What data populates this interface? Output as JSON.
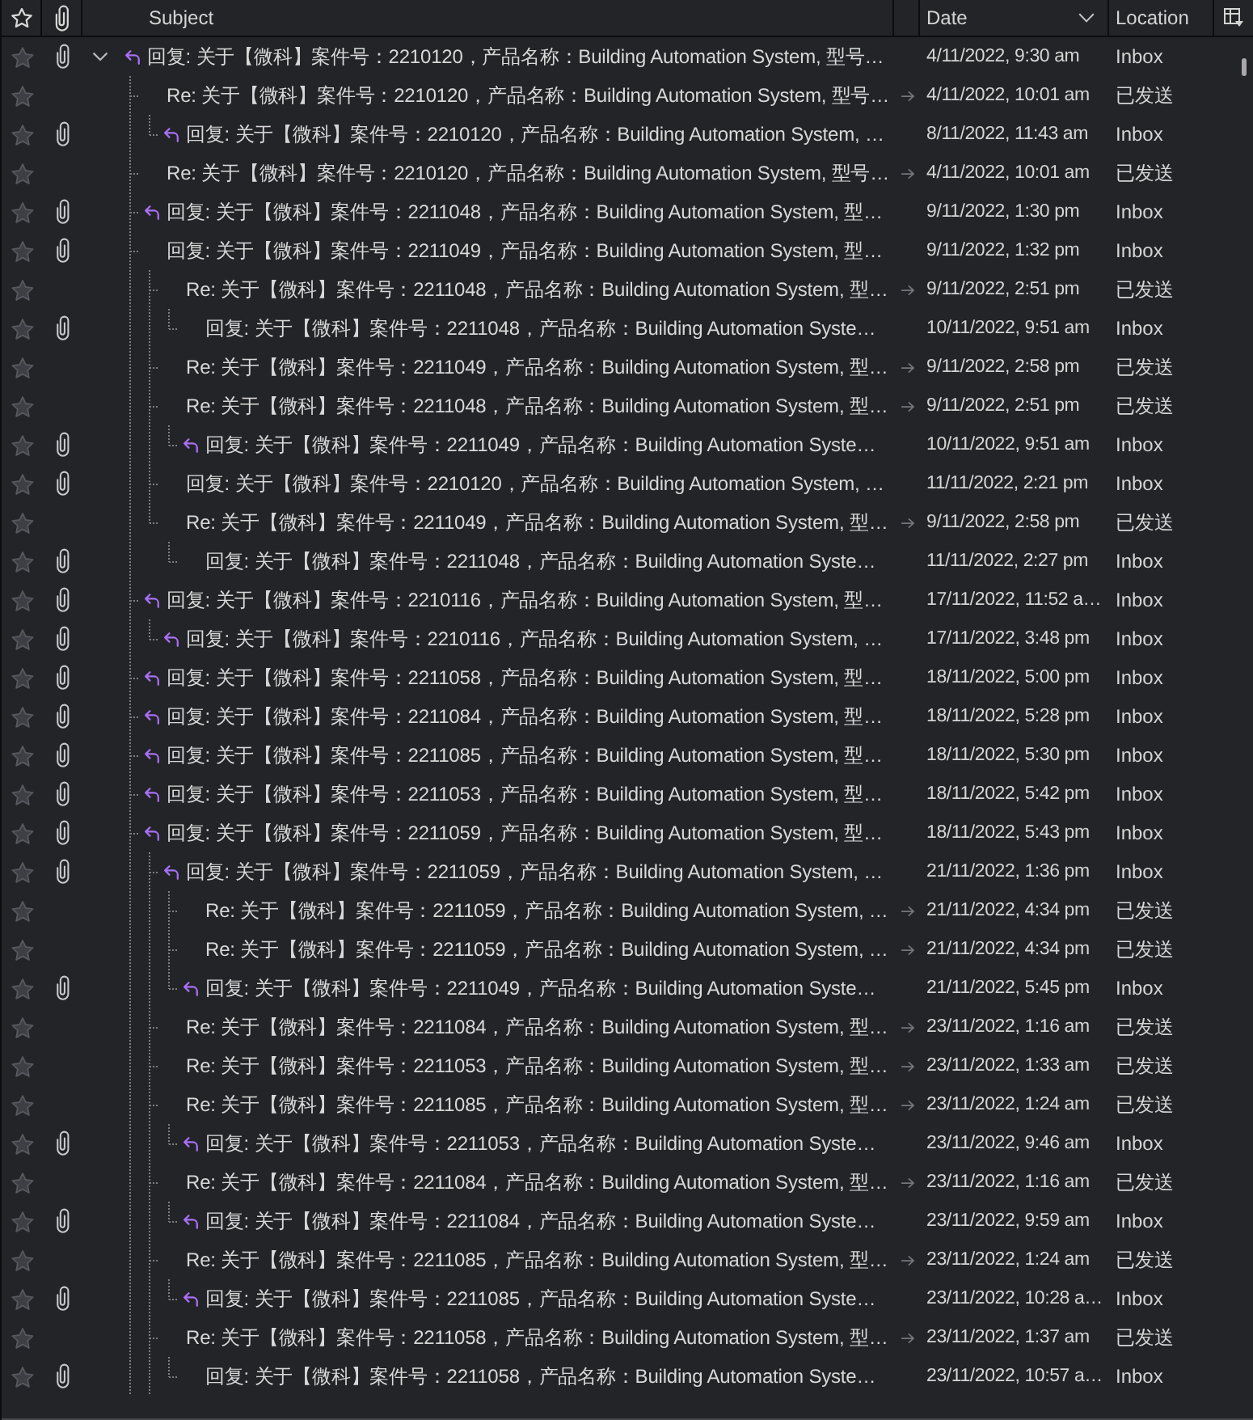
{
  "header": {
    "columns": [
      {
        "label": "Subject",
        "sorted": false
      },
      {
        "label": "Date",
        "sorted": true
      },
      {
        "label": "Location",
        "sorted": false
      }
    ]
  },
  "threads": [
    {
      "expanded": true,
      "more_replies_below": true,
      "starred": false,
      "attachment": true,
      "replied": true,
      "subject": "回复: 关于【微科】案件号：2210120，产品名称：Building Automation System, 型号…",
      "outgoing": false,
      "date": "4/11/2022, 9:30 am",
      "location": "Inbox",
      "children": [
        {
          "starred": false,
          "attachment": false,
          "replied": false,
          "subject": "Re: 关于【微科】案件号：2210120，产品名称：Building Automation System, 型号…",
          "outgoing": true,
          "date": "4/11/2022, 10:01 am",
          "location": "已发送",
          "children": [
            {
              "starred": false,
              "attachment": true,
              "replied": true,
              "subject": "回复: 关于【微科】案件号：2210120，产品名称：Building Automation System, …",
              "outgoing": false,
              "date": "8/11/2022, 11:43 am",
              "location": "Inbox"
            }
          ]
        },
        {
          "starred": false,
          "attachment": false,
          "replied": false,
          "subject": "Re: 关于【微科】案件号：2210120，产品名称：Building Automation System, 型号…",
          "outgoing": true,
          "date": "4/11/2022, 10:01 am",
          "location": "已发送"
        },
        {
          "starred": false,
          "attachment": true,
          "replied": true,
          "subject": "回复: 关于【微科】案件号：2211048，产品名称：Building Automation System, 型…",
          "outgoing": false,
          "date": "9/11/2022, 1:30 pm",
          "location": "Inbox"
        },
        {
          "starred": false,
          "attachment": true,
          "replied": false,
          "subject": "回复: 关于【微科】案件号：2211049，产品名称：Building Automation System, 型…",
          "outgoing": false,
          "date": "9/11/2022, 1:32 pm",
          "location": "Inbox",
          "children": [
            {
              "starred": false,
              "attachment": false,
              "replied": false,
              "subject": "Re: 关于【微科】案件号：2211048，产品名称：Building Automation System, 型…",
              "outgoing": true,
              "date": "9/11/2022, 2:51 pm",
              "location": "已发送",
              "children": [
                {
                  "starred": false,
                  "attachment": true,
                  "replied": false,
                  "subject": "回复: 关于【微科】案件号：2211048，产品名称：Building Automation Syste…",
                  "outgoing": false,
                  "date": "10/11/2022, 9:51 am",
                  "location": "Inbox"
                }
              ]
            },
            {
              "starred": false,
              "attachment": false,
              "replied": false,
              "subject": "Re: 关于【微科】案件号：2211049，产品名称：Building Automation System, 型…",
              "outgoing": true,
              "date": "9/11/2022, 2:58 pm",
              "location": "已发送"
            },
            {
              "starred": false,
              "attachment": false,
              "replied": false,
              "subject": "Re: 关于【微科】案件号：2211048，产品名称：Building Automation System, 型…",
              "outgoing": true,
              "date": "9/11/2022, 2:51 pm",
              "location": "已发送",
              "children": [
                {
                  "starred": false,
                  "attachment": true,
                  "replied": true,
                  "subject": "回复: 关于【微科】案件号：2211049，产品名称：Building Automation Syste…",
                  "outgoing": false,
                  "date": "10/11/2022, 9:51 am",
                  "location": "Inbox"
                }
              ]
            },
            {
              "starred": false,
              "attachment": true,
              "replied": false,
              "subject": "回复: 关于【微科】案件号：2210120，产品名称：Building Automation System, …",
              "outgoing": false,
              "date": "11/11/2022, 2:21 pm",
              "location": "Inbox"
            },
            {
              "starred": false,
              "attachment": false,
              "replied": false,
              "subject": "Re: 关于【微科】案件号：2211049，产品名称：Building Automation System, 型…",
              "outgoing": true,
              "date": "9/11/2022, 2:58 pm",
              "location": "已发送",
              "children": [
                {
                  "starred": false,
                  "attachment": true,
                  "replied": false,
                  "subject": "回复: 关于【微科】案件号：2211048，产品名称：Building Automation Syste…",
                  "outgoing": false,
                  "date": "11/11/2022, 2:27 pm",
                  "location": "Inbox"
                }
              ]
            }
          ]
        },
        {
          "starred": false,
          "attachment": true,
          "replied": true,
          "subject": "回复: 关于【微科】案件号：2210116，产品名称：Building Automation System, 型…",
          "outgoing": false,
          "date": "17/11/2022, 11:52 a…",
          "location": "Inbox",
          "children": [
            {
              "starred": false,
              "attachment": true,
              "replied": true,
              "subject": "回复: 关于【微科】案件号：2210116，产品名称：Building Automation System, …",
              "outgoing": false,
              "date": "17/11/2022, 3:48 pm",
              "location": "Inbox"
            }
          ]
        },
        {
          "starred": false,
          "attachment": true,
          "replied": true,
          "subject": "回复: 关于【微科】案件号：2211058，产品名称：Building Automation System, 型…",
          "outgoing": false,
          "date": "18/11/2022, 5:00 pm",
          "location": "Inbox"
        },
        {
          "starred": false,
          "attachment": true,
          "replied": true,
          "subject": "回复: 关于【微科】案件号：2211084，产品名称：Building Automation System, 型…",
          "outgoing": false,
          "date": "18/11/2022, 5:28 pm",
          "location": "Inbox"
        },
        {
          "starred": false,
          "attachment": true,
          "replied": true,
          "subject": "回复: 关于【微科】案件号：2211085，产品名称：Building Automation System, 型…",
          "outgoing": false,
          "date": "18/11/2022, 5:30 pm",
          "location": "Inbox"
        },
        {
          "starred": false,
          "attachment": true,
          "replied": true,
          "subject": "回复: 关于【微科】案件号：2211053，产品名称：Building Automation System, 型…",
          "outgoing": false,
          "date": "18/11/2022, 5:42 pm",
          "location": "Inbox"
        },
        {
          "more_replies_below": true,
          "starred": false,
          "attachment": true,
          "replied": true,
          "subject": "回复: 关于【微科】案件号：2211059，产品名称：Building Automation System, 型…",
          "outgoing": false,
          "date": "18/11/2022, 5:43 pm",
          "location": "Inbox",
          "children": [
            {
              "starred": false,
              "attachment": true,
              "replied": true,
              "subject": "回复: 关于【微科】案件号：2211059，产品名称：Building Automation System, …",
              "outgoing": false,
              "date": "21/11/2022, 1:36 pm",
              "location": "Inbox",
              "children": [
                {
                  "starred": false,
                  "attachment": false,
                  "replied": false,
                  "subject": "Re: 关于【微科】案件号：2211059，产品名称：Building Automation System, …",
                  "outgoing": true,
                  "date": "21/11/2022, 4:34 pm",
                  "location": "已发送"
                },
                {
                  "starred": false,
                  "attachment": false,
                  "replied": false,
                  "subject": "Re: 关于【微科】案件号：2211059，产品名称：Building Automation System, …",
                  "outgoing": true,
                  "date": "21/11/2022, 4:34 pm",
                  "location": "已发送"
                },
                {
                  "starred": false,
                  "attachment": true,
                  "replied": true,
                  "subject": "回复: 关于【微科】案件号：2211049，产品名称：Building Automation Syste…",
                  "outgoing": false,
                  "date": "21/11/2022, 5:45 pm",
                  "location": "Inbox"
                }
              ]
            },
            {
              "starred": false,
              "attachment": false,
              "replied": false,
              "subject": "Re: 关于【微科】案件号：2211084，产品名称：Building Automation System, 型…",
              "outgoing": true,
              "date": "23/11/2022, 1:16 am",
              "location": "已发送"
            },
            {
              "starred": false,
              "attachment": false,
              "replied": false,
              "subject": "Re: 关于【微科】案件号：2211053，产品名称：Building Automation System, 型…",
              "outgoing": true,
              "date": "23/11/2022, 1:33 am",
              "location": "已发送"
            },
            {
              "starred": false,
              "attachment": false,
              "replied": false,
              "subject": "Re: 关于【微科】案件号：2211085，产品名称：Building Automation System, 型…",
              "outgoing": true,
              "date": "23/11/2022, 1:24 am",
              "location": "已发送",
              "children": [
                {
                  "starred": false,
                  "attachment": true,
                  "replied": true,
                  "subject": "回复: 关于【微科】案件号：2211053，产品名称：Building Automation Syste…",
                  "outgoing": false,
                  "date": "23/11/2022, 9:46 am",
                  "location": "Inbox"
                }
              ]
            },
            {
              "starred": false,
              "attachment": false,
              "replied": false,
              "subject": "Re: 关于【微科】案件号：2211084，产品名称：Building Automation System, 型…",
              "outgoing": true,
              "date": "23/11/2022, 1:16 am",
              "location": "已发送",
              "children": [
                {
                  "starred": false,
                  "attachment": true,
                  "replied": true,
                  "subject": "回复: 关于【微科】案件号：2211084，产品名称：Building Automation Syste…",
                  "outgoing": false,
                  "date": "23/11/2022, 9:59 am",
                  "location": "Inbox"
                }
              ]
            },
            {
              "starred": false,
              "attachment": false,
              "replied": false,
              "subject": "Re: 关于【微科】案件号：2211085，产品名称：Building Automation System, 型…",
              "outgoing": true,
              "date": "23/11/2022, 1:24 am",
              "location": "已发送",
              "children": [
                {
                  "starred": false,
                  "attachment": true,
                  "replied": true,
                  "subject": "回复: 关于【微科】案件号：2211085，产品名称：Building Automation Syste…",
                  "outgoing": false,
                  "date": "23/11/2022, 10:28 a…",
                  "location": "Inbox"
                }
              ]
            },
            {
              "starred": false,
              "attachment": false,
              "replied": false,
              "subject": "Re: 关于【微科】案件号：2211058，产品名称：Building Automation System, 型…",
              "outgoing": true,
              "date": "23/11/2022, 1:37 am",
              "location": "已发送",
              "children": [
                {
                  "starred": false,
                  "attachment": true,
                  "replied": false,
                  "subject": "回复: 关于【微科】案件号：2211058，产品名称：Building Automation Syste…",
                  "outgoing": false,
                  "date": "23/11/2022, 10:57 a…",
                  "location": "Inbox"
                }
              ]
            }
          ]
        }
      ]
    }
  ]
}
